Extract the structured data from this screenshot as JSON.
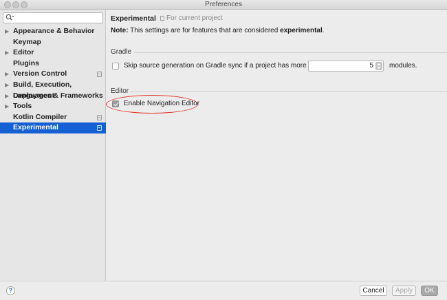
{
  "window": {
    "title": "Preferences"
  },
  "search": {
    "placeholder": "",
    "value": ""
  },
  "sidebar": {
    "items": [
      {
        "label": "Appearance & Behavior",
        "expandable": true,
        "project": false,
        "selected": false
      },
      {
        "label": "Keymap",
        "expandable": false,
        "project": false,
        "selected": false
      },
      {
        "label": "Editor",
        "expandable": true,
        "project": false,
        "selected": false
      },
      {
        "label": "Plugins",
        "expandable": false,
        "project": false,
        "selected": false
      },
      {
        "label": "Version Control",
        "expandable": true,
        "project": true,
        "selected": false
      },
      {
        "label": "Build, Execution, Deployment",
        "expandable": true,
        "project": false,
        "selected": false
      },
      {
        "label": "Languages & Frameworks",
        "expandable": true,
        "project": false,
        "selected": false
      },
      {
        "label": "Tools",
        "expandable": true,
        "project": false,
        "selected": false
      },
      {
        "label": "Kotlin Compiler",
        "expandable": false,
        "project": true,
        "selected": false
      },
      {
        "label": "Experimental",
        "expandable": false,
        "project": true,
        "selected": true
      }
    ]
  },
  "main": {
    "title": "Experimental",
    "scope_label": "For current project",
    "note_prefix": "Note:",
    "note_text": " This settings are for features that are considered ",
    "note_emphasis": "experimental",
    "note_suffix": ".",
    "gradle": {
      "section_label": "Gradle",
      "skip_label": "Skip source generation on Gradle sync if a project has more than",
      "skip_checked": false,
      "modules_value": "5",
      "modules_suffix": "modules."
    },
    "editor": {
      "section_label": "Editor",
      "nav_editor_label": "Enable Navigation Editor",
      "nav_editor_checked": true
    }
  },
  "footer": {
    "help_label": "?",
    "cancel_label": "Cancel",
    "apply_label": "Apply",
    "ok_label": "OK"
  },
  "colors": {
    "selection": "#1560d4",
    "annotation_circle": "#e0342a"
  }
}
